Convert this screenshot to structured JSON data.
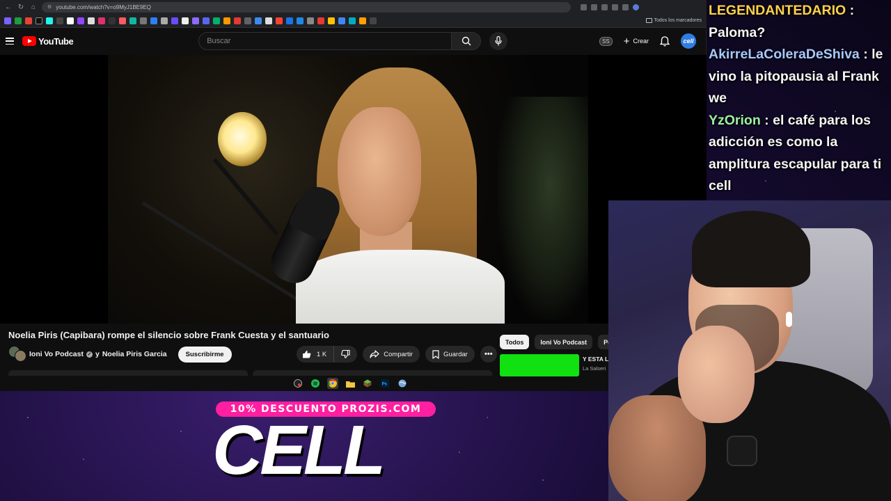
{
  "browser": {
    "url": "youtube.com/watch?v=o9MyJ1BE9EQ",
    "bookmarks_folder": "Todos los marcadores"
  },
  "youtube": {
    "logo_text": "YouTube",
    "search_placeholder": "Buscar",
    "badge": "SS",
    "create_label": "Crear",
    "avatar_text": "cell"
  },
  "video": {
    "title": "Noelia Piris (Capibara) rompe el silencio sobre Frank Cuesta y el santuario",
    "channel": "Ioni Vo Podcast",
    "channel_joiner": "y",
    "collaborator": "Noelia Piris Garcia",
    "subscribe_label": "Suscribirme",
    "likes": "1 K",
    "share_label": "Compartir",
    "save_label": "Guardar"
  },
  "chips": [
    "Todos",
    "Ioni Vo Podcast",
    "Pó"
  ],
  "recommendation": {
    "title": "Y ESTA L",
    "channel": "La Salseri"
  },
  "chat": [
    {
      "user": "LEGENDANTEDARIO",
      "message": "Paloma?",
      "color": "#ffd24a"
    },
    {
      "user": "AkirreLaColeraDeShiva",
      "message": "le vino la pitopausia al Frank we",
      "color": "#a8c8ff"
    },
    {
      "user": "YzOrion",
      "message": "el café para los adicción es como la amplitura escapular para ti cell",
      "color": "#9cf0a0"
    }
  ],
  "promo": {
    "badge_text": "10% DESCUENTO PROZIS.COM",
    "word": "CELL"
  },
  "colors": {
    "yt_red": "#ff0000",
    "promo_pink": "#ff1fa0",
    "green_thumb": "#11e011"
  }
}
